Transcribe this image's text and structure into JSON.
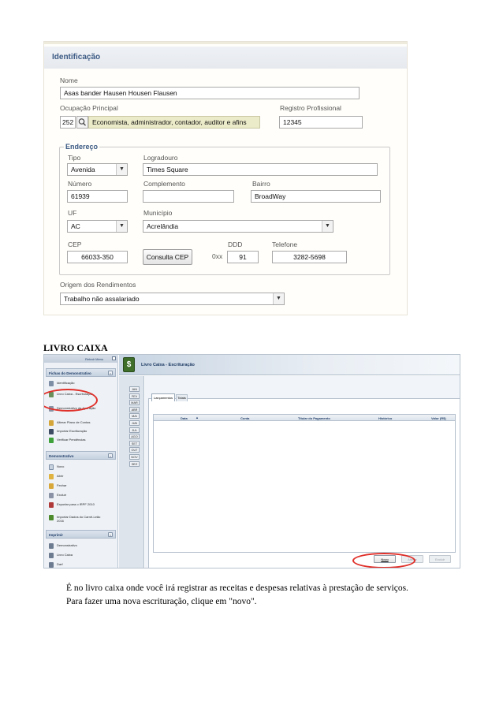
{
  "identificacao": {
    "title": "Identificação",
    "nome": {
      "label": "Nome",
      "value": "Asas bander Hausen Housen Flausen"
    },
    "ocupacao": {
      "label": "Ocupação Principal",
      "code": "252",
      "value": "Economista, administrador, contador, auditor e afins"
    },
    "registro": {
      "label": "Registro Profissional",
      "value": "12345"
    },
    "endereco": {
      "legend": "Endereço",
      "tipo": {
        "label": "Tipo",
        "value": "Avenida"
      },
      "logradouro": {
        "label": "Logradouro",
        "value": "Times Square"
      },
      "numero": {
        "label": "Número",
        "value": "61939"
      },
      "complemento": {
        "label": "Complemento",
        "value": ""
      },
      "bairro": {
        "label": "Bairro",
        "value": "BroadWay"
      },
      "uf": {
        "label": "UF",
        "value": "AC"
      },
      "municipio": {
        "label": "Município",
        "value": "Acrelândia"
      },
      "cep": {
        "label": "CEP",
        "value": "66033-350"
      },
      "consulta_cep": "Consulta CEP",
      "ddd": {
        "label": "DDD",
        "prefix": "0xx",
        "value": "91"
      },
      "telefone": {
        "label": "Telefone",
        "value": "3282-5698"
      }
    },
    "origem": {
      "label": "Origem dos Rendimentos",
      "value": "Trabalho não assalariado"
    }
  },
  "section_heading": "LIVRO CAIXA",
  "livro_caixa": {
    "topbar_link": "Retrair Menu",
    "window_title": "Livro Caixa - Escrituração",
    "sidebar": {
      "fichas": {
        "title": "Fichas do Demonstrativo",
        "items": [
          "Identificação",
          "Livro Caixa - Escrituração",
          "Demonstrativo da Apuração",
          "Alterar Plano de Contas",
          "Importar Escrituração",
          "Verificar Pendências"
        ]
      },
      "demonstrativo": {
        "title": "Demonstrativo",
        "items": [
          "Novo",
          "Abrir",
          "Fechar",
          "Excluir",
          "Exportar para o IRPF 2010",
          "Importar Dados do Carnê-Leão 2016"
        ]
      },
      "imprimir": {
        "title": "Imprimir",
        "items": [
          "Demonstrativo",
          "Livro Caixa",
          "Darf"
        ]
      }
    },
    "months": [
      "JAN",
      "FEV",
      "MAR",
      "ABR",
      "MAI",
      "JUN",
      "JUL",
      "AGO",
      "SET",
      "OUT",
      "NOV",
      "DEZ"
    ],
    "tabs": [
      "Lançamentos",
      "Totais"
    ],
    "columns": [
      "Data",
      "Conta",
      "Titular do Pagamento",
      "Histórico",
      "Valor (R$)"
    ],
    "buttons": {
      "novo": "Novo",
      "alterar": "Alterar",
      "excluir": "Excluir"
    }
  },
  "caption": {
    "line1": "É no livro caixa onde você irá registrar as receitas e despesas relativas à prestação de serviços.",
    "line2": "Para fazer uma nova escrituração, clique em \"novo\"."
  },
  "colors": {
    "header_text": "#3c5a84",
    "ocupacao_bg": "#ecebc9",
    "highlight_circle": "#e0302a",
    "app_green": "#4c8a2c"
  }
}
